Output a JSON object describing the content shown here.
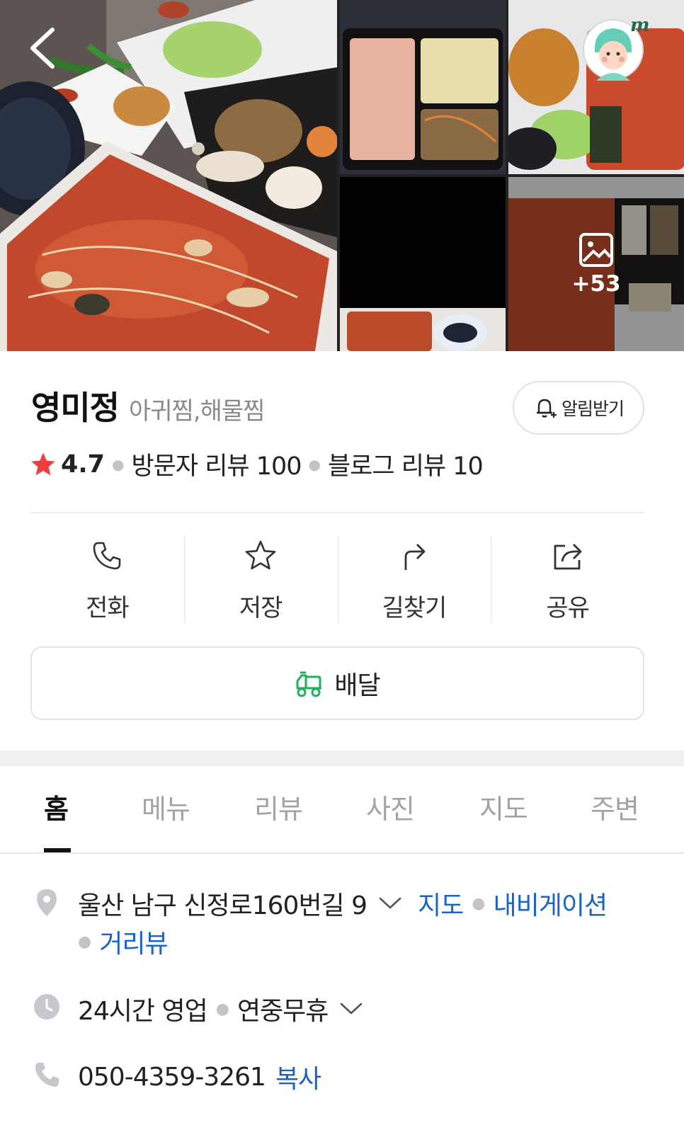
{
  "place": {
    "name": "영미정",
    "category": "아귀찜,해물찜",
    "alarm_label": "알림받기",
    "rating": "4.7",
    "visitor_reviews": "방문자 리뷰 100",
    "blog_reviews": "블로그 리뷰 10"
  },
  "gallery": {
    "more_count": "+53",
    "avatar_badge": "my"
  },
  "actions": [
    {
      "label": "전화",
      "icon": "phone-icon"
    },
    {
      "label": "저장",
      "icon": "star-icon"
    },
    {
      "label": "길찾기",
      "icon": "directions-icon"
    },
    {
      "label": "공유",
      "icon": "share-icon"
    }
  ],
  "delivery_label": "배달",
  "tabs": [
    "홈",
    "메뉴",
    "리뷰",
    "사진",
    "지도",
    "주변"
  ],
  "info": {
    "address": "울산 남구 신정로160번길 9",
    "map_link": "지도",
    "navi_link": "내비게이션",
    "roadview_link": "거리뷰",
    "hours": "24시간 영업",
    "holiday": "연중무휴",
    "phone": "050-4359-3261",
    "copy_link": "복사"
  },
  "colors": {
    "accent_blue": "#1a63c7",
    "star_red": "#f03e3e",
    "delivery_green": "#1fb25a"
  }
}
